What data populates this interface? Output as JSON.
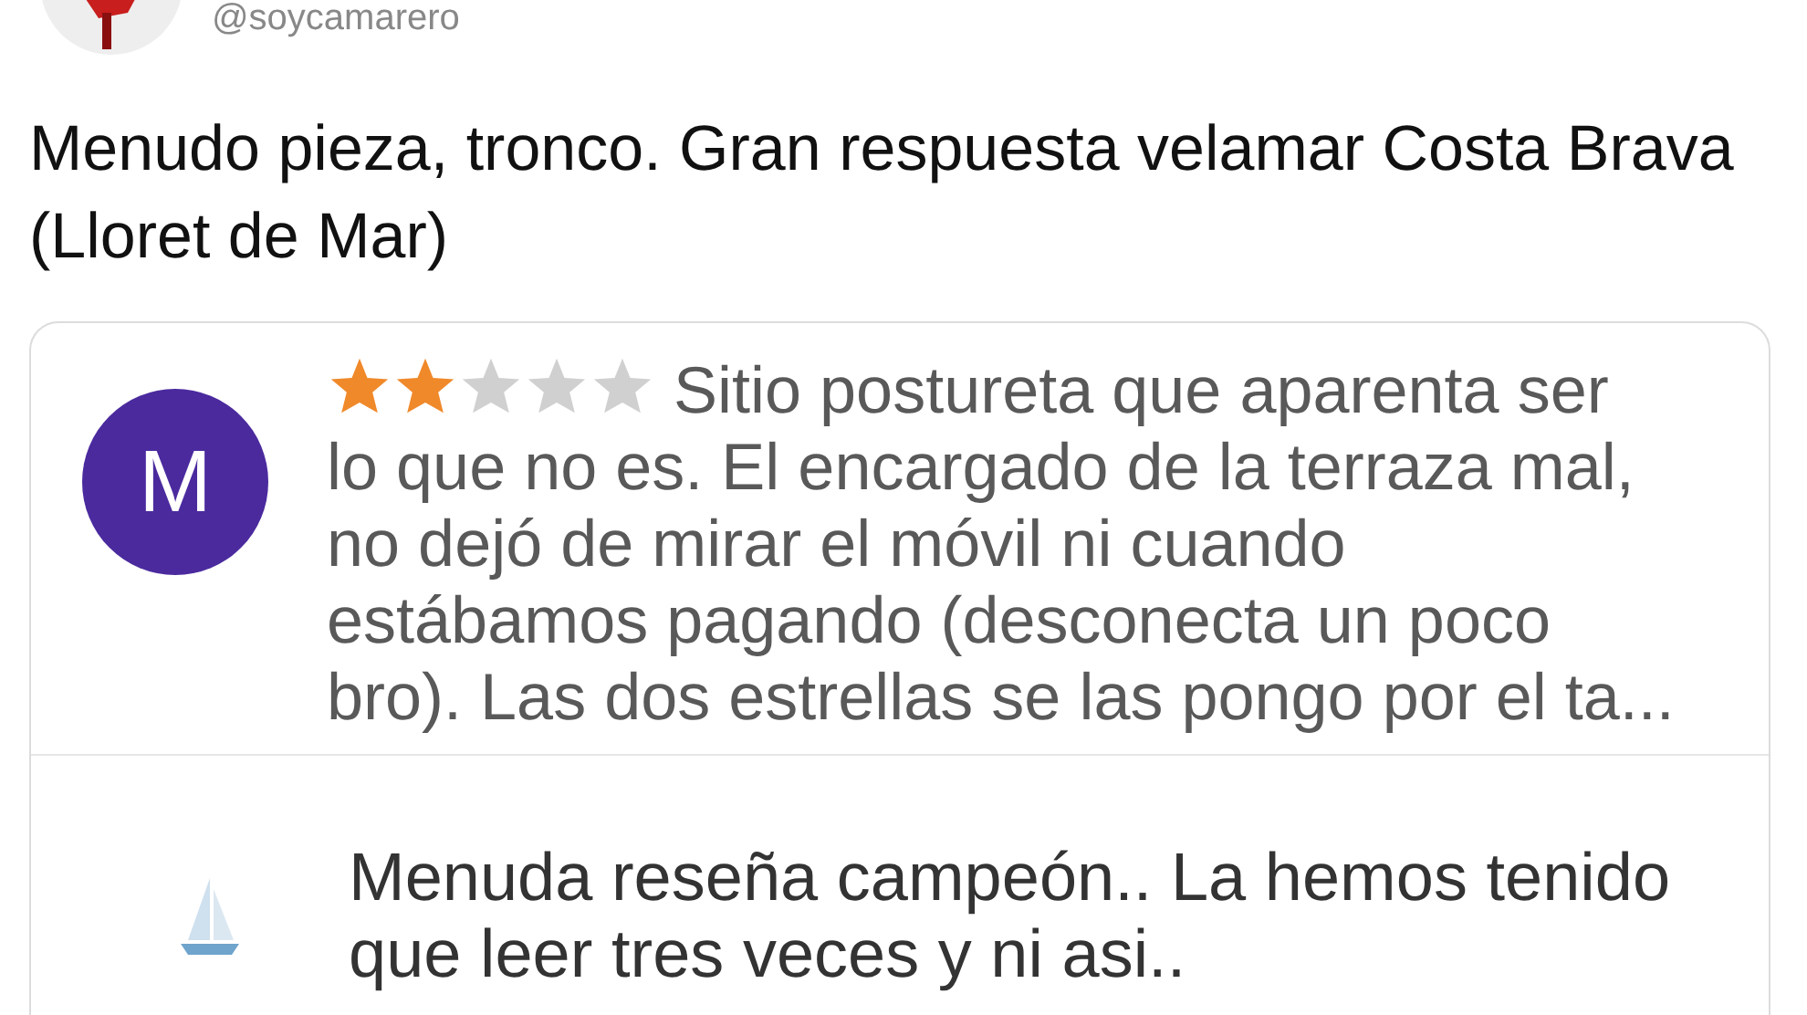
{
  "tweet": {
    "handle": "@soycamarero",
    "text": "Menudo pieza, tronco. Gran respuesta velamar Costa Brava (Lloret de Mar)"
  },
  "review_card": {
    "review": {
      "avatar_letter": "M",
      "stars": 2,
      "text": "Sitio postureta que aparenta ser lo que no es. El encargado de la terraza mal, no dejó de mirar el móvil ni cuando estábamos pagando (desconecta un poco bro). Las dos estrellas se las pongo por el ta..."
    },
    "reply": {
      "text": "Menuda reseña campeón.. La hemos tenido que leer tres veces y ni asi.."
    }
  }
}
